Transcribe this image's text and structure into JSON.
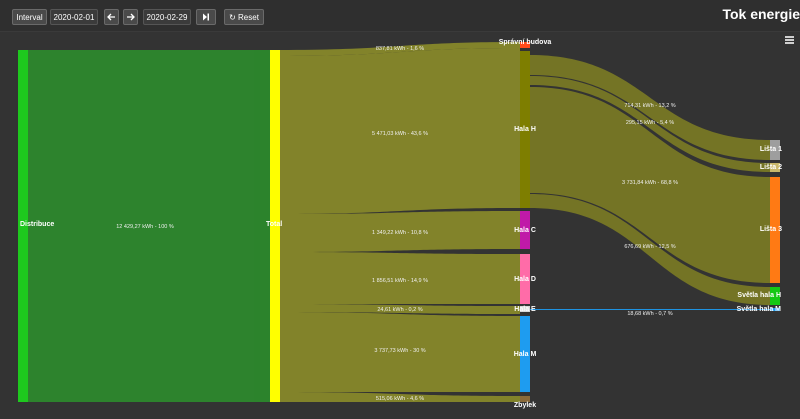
{
  "toolbar": {
    "interval_label": "Interval",
    "start_date": "2020-02-01",
    "prev_icon": "arrow-left-icon",
    "next_icon": "arrow-right-icon",
    "end_date": "2020-02-29",
    "skip_end_icon": "skip-to-end-icon",
    "reset_icon": "reset-icon",
    "reset_label": "Reset"
  },
  "header": {
    "title": "Tok energie"
  },
  "menu_icon": "hamburger-menu-icon",
  "colors": {
    "flow": "#898a2a",
    "distribuce": "#1ec81e",
    "distribuce_block": "#2c8a2c",
    "total": "#ffff00",
    "spravni_budova": "#ff4a1a",
    "hala_h": "#7e7e00",
    "hala_c": "#c01aa8",
    "hala_d": "#ff6ca8",
    "hala_e": "#d8d8d8",
    "hala_m": "#1e9cf0",
    "zbytek": "#8a6a3a",
    "lista_1": "#9e9e9e",
    "lista_2": "#c9b86a",
    "lista_3": "#ff7a14",
    "svetla_hala_h": "#14c814",
    "svetla_hala_m": "#1e9cf0"
  },
  "nodes": {
    "distribuce": "Distribuce",
    "total": "Total",
    "spravni_budova": "Správní budova",
    "hala_h": "Hala H",
    "hala_c": "Hala C",
    "hala_d": "Hala D",
    "hala_e": "Hala E",
    "hala_m": "Hala M",
    "zbytek": "Zbylek",
    "lista_1": "Lišta 1",
    "lista_2": "Lišta 2",
    "lista_3": "Lišta 3",
    "svetla_hala_h": "Světla hala H",
    "svetla_hala_m": "Světla hala M"
  },
  "flows": {
    "distribuce_total": "12 429,27 kWh - 100 %",
    "total_spravni": "837,81 kWh - 1,6 %",
    "total_hala_h": "5 471,03 kWh - 43,6 %",
    "total_hala_c": "1 349,22 kWh - 10,8 %",
    "total_hala_d": "1 856,51 kWh - 14,9 %",
    "total_hala_e": "24,61 kWh - 0,2 %",
    "total_hala_m": "3 737,73 kWh - 30 %",
    "total_zbytek": "515,06 kWh - 4,6 %",
    "hala_h_lista_1": "714,31 kWh - 13,2 %",
    "hala_h_lista_2": "295,15 kWh - 5,4 %",
    "hala_h_lista_3": "3 731,84 kWh - 68,8 %",
    "hala_h_svetla_h": "676,69 kWh - 12,5 %",
    "hala_e_svetla_m": "18,68 kWh - 0,7 %"
  }
}
